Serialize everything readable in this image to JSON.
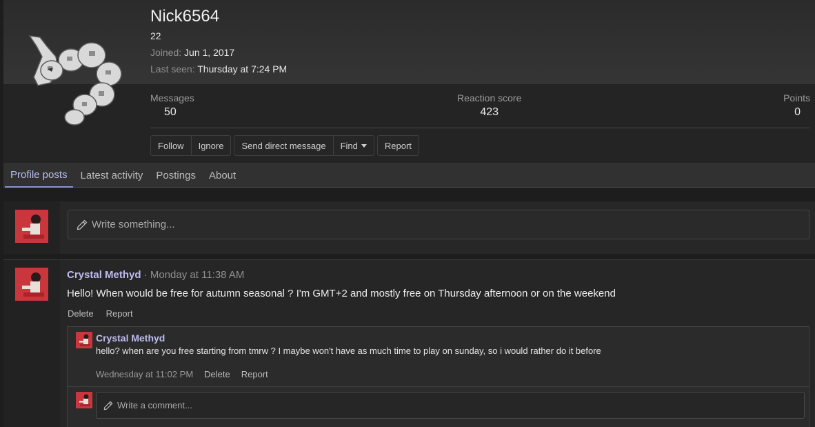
{
  "profile": {
    "username": "Nick6564",
    "user_title": "22",
    "joined_label": "Joined:",
    "joined_value": "Jun 1, 2017",
    "last_seen_label": "Last seen:",
    "last_seen_value": "Thursday at 7:24 PM",
    "stats": [
      {
        "label": "Messages",
        "value": "50"
      },
      {
        "label": "Reaction score",
        "value": "423"
      },
      {
        "label": "Points",
        "value": "0"
      }
    ],
    "buttons": {
      "follow": "Follow",
      "ignore": "Ignore",
      "send_dm": "Send direct message",
      "find": "Find",
      "report": "Report"
    }
  },
  "tabs": [
    {
      "label": "Profile posts",
      "active": true
    },
    {
      "label": "Latest activity",
      "active": false
    },
    {
      "label": "Postings",
      "active": false
    },
    {
      "label": "About",
      "active": false
    }
  ],
  "composer": {
    "placeholder": "Write something..."
  },
  "post": {
    "author": "Crystal Methyd",
    "separator": " · ",
    "time": "Monday at 11:38 AM",
    "text": "Hello! When would be free for autumn seasonal ? I'm GMT+2 and mostly free on Thursday afternoon or on the weekend",
    "actions": {
      "delete": "Delete",
      "report": "Report"
    },
    "comment": {
      "author": "Crystal Methyd",
      "text": "hello? when are you free starting from tmrw ? I maybe won't have as much time to play on sunday, so i would rather do it before",
      "time": "Wednesday at 11:02 PM",
      "delete": "Delete",
      "report": "Report"
    },
    "reply_placeholder": "Write a comment..."
  },
  "colors": {
    "accent": "#bcbdf0",
    "active_tab_underline": "#8a93d8",
    "background": "#1d1d1d"
  }
}
